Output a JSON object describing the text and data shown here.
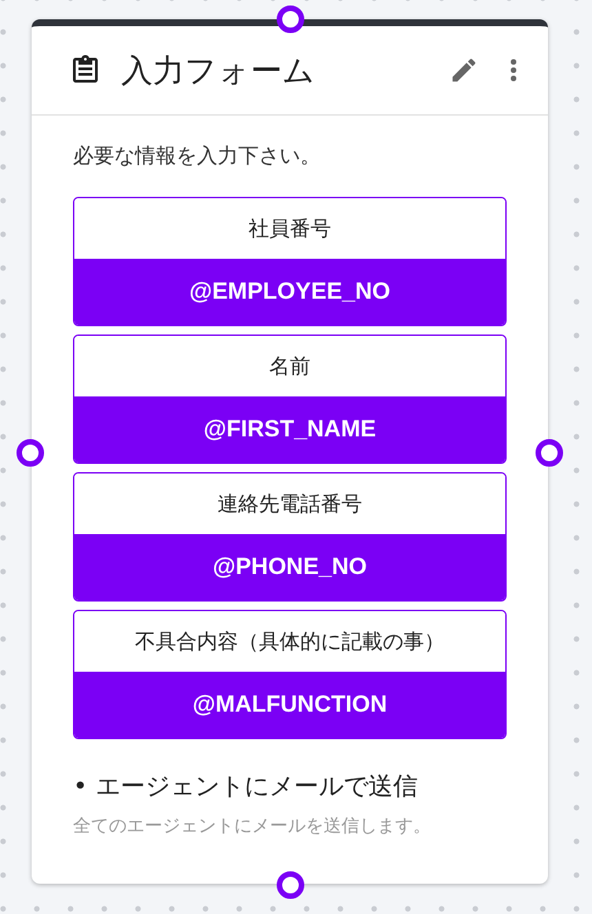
{
  "card": {
    "title": "入力フォーム",
    "description": "必要な情報を入力下さい。",
    "fields": [
      {
        "label": "社員番号",
        "variable": "@EMPLOYEE_NO"
      },
      {
        "label": "名前",
        "variable": "@FIRST_NAME"
      },
      {
        "label": "連絡先電話番号",
        "variable": "@PHONE_NO"
      },
      {
        "label": "不具合内容（具体的に記載の事）",
        "variable": "@MALFUNCTION"
      }
    ],
    "action": {
      "title": "• エージェントにメールで送信",
      "subtitle": "全てのエージェントにメールを送信します。"
    }
  }
}
